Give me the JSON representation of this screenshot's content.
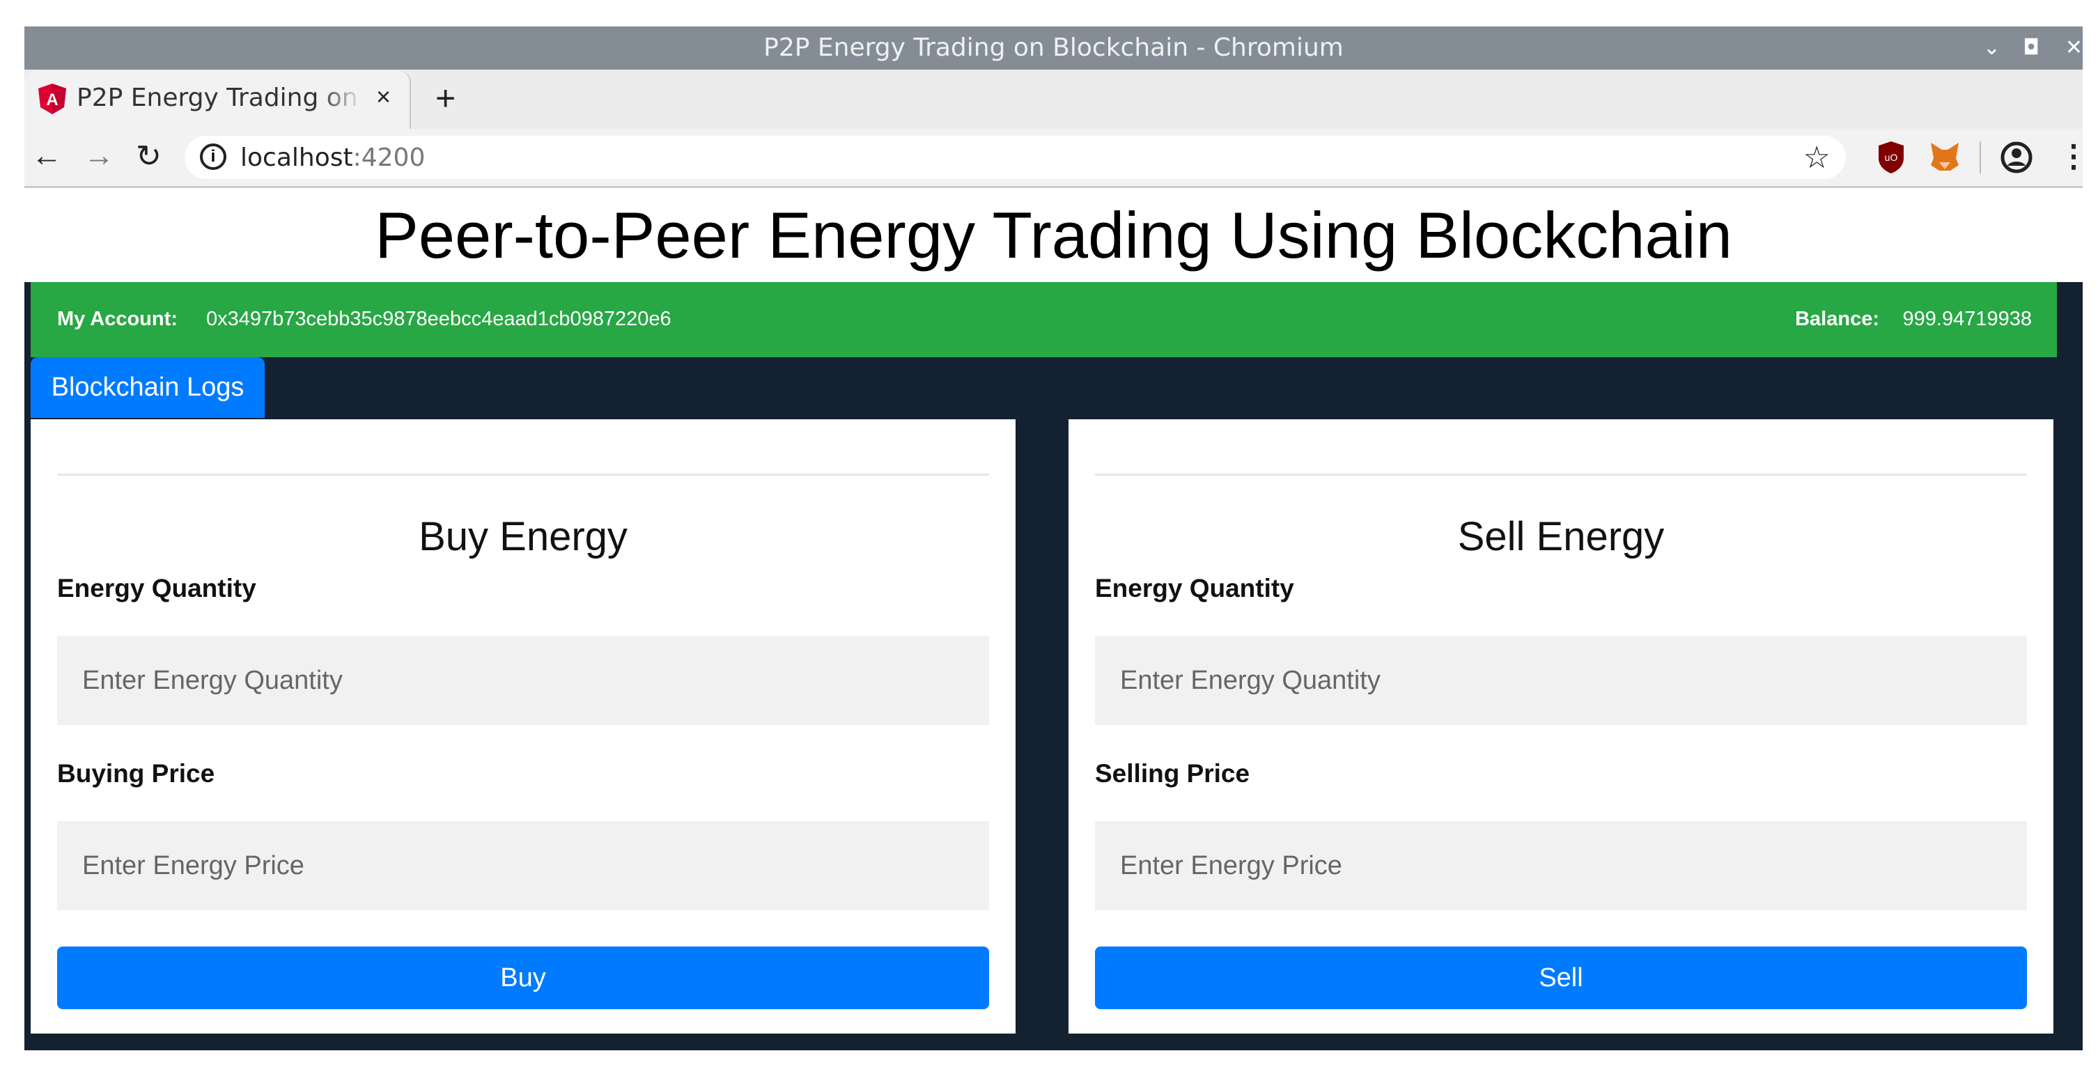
{
  "window": {
    "title": "P2P Energy Trading on Blockchain - Chromium"
  },
  "tab": {
    "label": "P2P Energy Trading on Blockchain",
    "close": "×",
    "new_tab": "+"
  },
  "toolbar": {
    "url_host": "localhost",
    "url_port": ":4200"
  },
  "page": {
    "title": "Peer-to-Peer Energy Trading Using Blockchain"
  },
  "account": {
    "label": "My Account:",
    "address": "0x3497b73cebb35c9878eebcc4eaad1cb0987220e6",
    "balance_label": "Balance:",
    "balance": "999.94719938"
  },
  "nav": {
    "logs_label": "Blockchain Logs"
  },
  "buy": {
    "title": "Buy Energy",
    "quantity_label": "Energy Quantity",
    "quantity_placeholder": "Enter Energy Quantity",
    "price_label": "Buying Price",
    "price_placeholder": "Enter Energy Price",
    "button": "Buy"
  },
  "sell": {
    "title": "Sell Energy",
    "quantity_label": "Energy Quantity",
    "quantity_placeholder": "Enter Energy Quantity",
    "price_label": "Selling Price",
    "price_placeholder": "Enter Energy Price",
    "button": "Sell"
  },
  "colors": {
    "green": "#28a745",
    "primary": "#007bff",
    "dark": "#132131"
  },
  "icons": [
    "angular-icon",
    "back-icon",
    "forward-icon",
    "reload-icon",
    "info-icon",
    "star-icon",
    "ublock-icon",
    "metamask-icon",
    "profile-icon",
    "menu-icon"
  ]
}
